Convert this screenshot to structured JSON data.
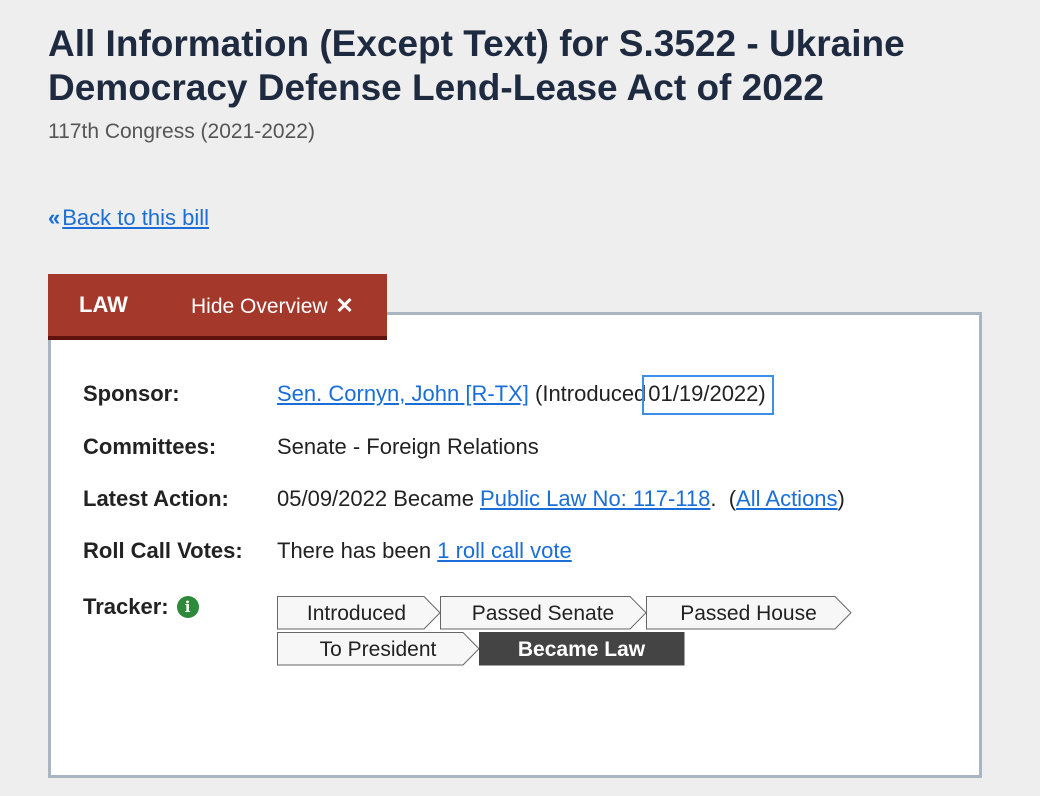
{
  "header": {
    "title": "All Information (Except Text) for S.3522 - Ukraine Democracy Defense Lend-Lease Act of 2022",
    "congress": "117th Congress (2021-2022)",
    "back_label": "Back to this bill",
    "back_icon": "double-chevron-left-icon"
  },
  "status_bar": {
    "status": "LAW",
    "hide_overview_label": "Hide Overview",
    "close_icon": "close-icon",
    "background_color": "#a4382b"
  },
  "overview": {
    "sponsor": {
      "label": "Sponsor:",
      "name": "Sen. Cornyn, John [R-TX]",
      "introduced_prefix": " (Introduced ",
      "introduced_date": "01/19/2022)"
    },
    "committees": {
      "label": "Committees:",
      "value": "Senate - Foreign Relations"
    },
    "latest_action": {
      "label": "Latest Action:",
      "prefix": "05/09/2022 Became ",
      "law_link": "Public Law No: 117-118",
      "middle": ".  (",
      "all_actions": "All Actions",
      "suffix": ")"
    },
    "roll_call": {
      "label": "Roll Call Votes:",
      "prefix": "There has been ",
      "link": "1 roll call vote"
    },
    "tracker": {
      "label": "Tracker:",
      "info_icon": "info-icon",
      "steps": [
        "Introduced",
        "Passed Senate",
        "Passed House",
        "To President",
        "Became Law"
      ],
      "current_step": "Became Law",
      "current_color": "#444444"
    }
  }
}
